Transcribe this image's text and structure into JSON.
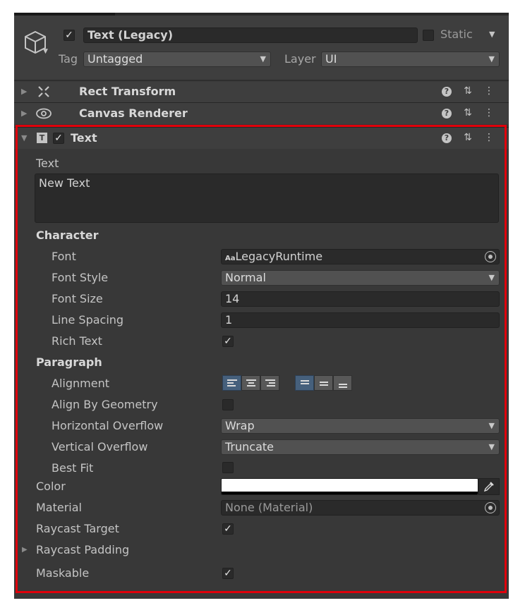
{
  "gameobject": {
    "active": true,
    "name": "Text (Legacy)",
    "static_label": "Static",
    "static_checked": false,
    "tag_label": "Tag",
    "tag_value": "Untagged",
    "layer_label": "Layer",
    "layer_value": "UI"
  },
  "components": {
    "rect_transform": "Rect Transform",
    "canvas_renderer": "Canvas Renderer",
    "text_title": "Text",
    "text_enabled": true
  },
  "text_component": {
    "text_label": "Text",
    "text_value": "New Text",
    "character_header": "Character",
    "font_label": "Font",
    "font_prefix": "Aa",
    "font_value": "LegacyRuntime",
    "font_style_label": "Font Style",
    "font_style_value": "Normal",
    "font_size_label": "Font Size",
    "font_size_value": "14",
    "line_spacing_label": "Line Spacing",
    "line_spacing_value": "1",
    "rich_text_label": "Rich Text",
    "rich_text_checked": true,
    "paragraph_header": "Paragraph",
    "alignment_label": "Alignment",
    "alignment_horizontal": "left",
    "alignment_vertical": "upper",
    "align_by_geometry_label": "Align By Geometry",
    "align_by_geometry_checked": false,
    "horizontal_overflow_label": "Horizontal Overflow",
    "horizontal_overflow_value": "Wrap",
    "vertical_overflow_label": "Vertical Overflow",
    "vertical_overflow_value": "Truncate",
    "best_fit_label": "Best Fit",
    "best_fit_checked": false,
    "color_label": "Color",
    "color_value": "#ffffff",
    "material_label": "Material",
    "material_value": "None (Material)",
    "raycast_target_label": "Raycast Target",
    "raycast_target_checked": true,
    "raycast_padding_label": "Raycast Padding",
    "maskable_label": "Maskable",
    "maskable_checked": true
  },
  "icons": {
    "checkmark": "✓",
    "fold_closed": "▶",
    "fold_open": "▼",
    "dropdown": "▼",
    "help": "?",
    "presets": "⇅",
    "more": "⋮",
    "eyedropper": "eyedropper-icon"
  },
  "colors": {
    "highlight_frame": "#e0000b",
    "panel_bg": "#383838",
    "selected_alignment": "#46607c"
  }
}
